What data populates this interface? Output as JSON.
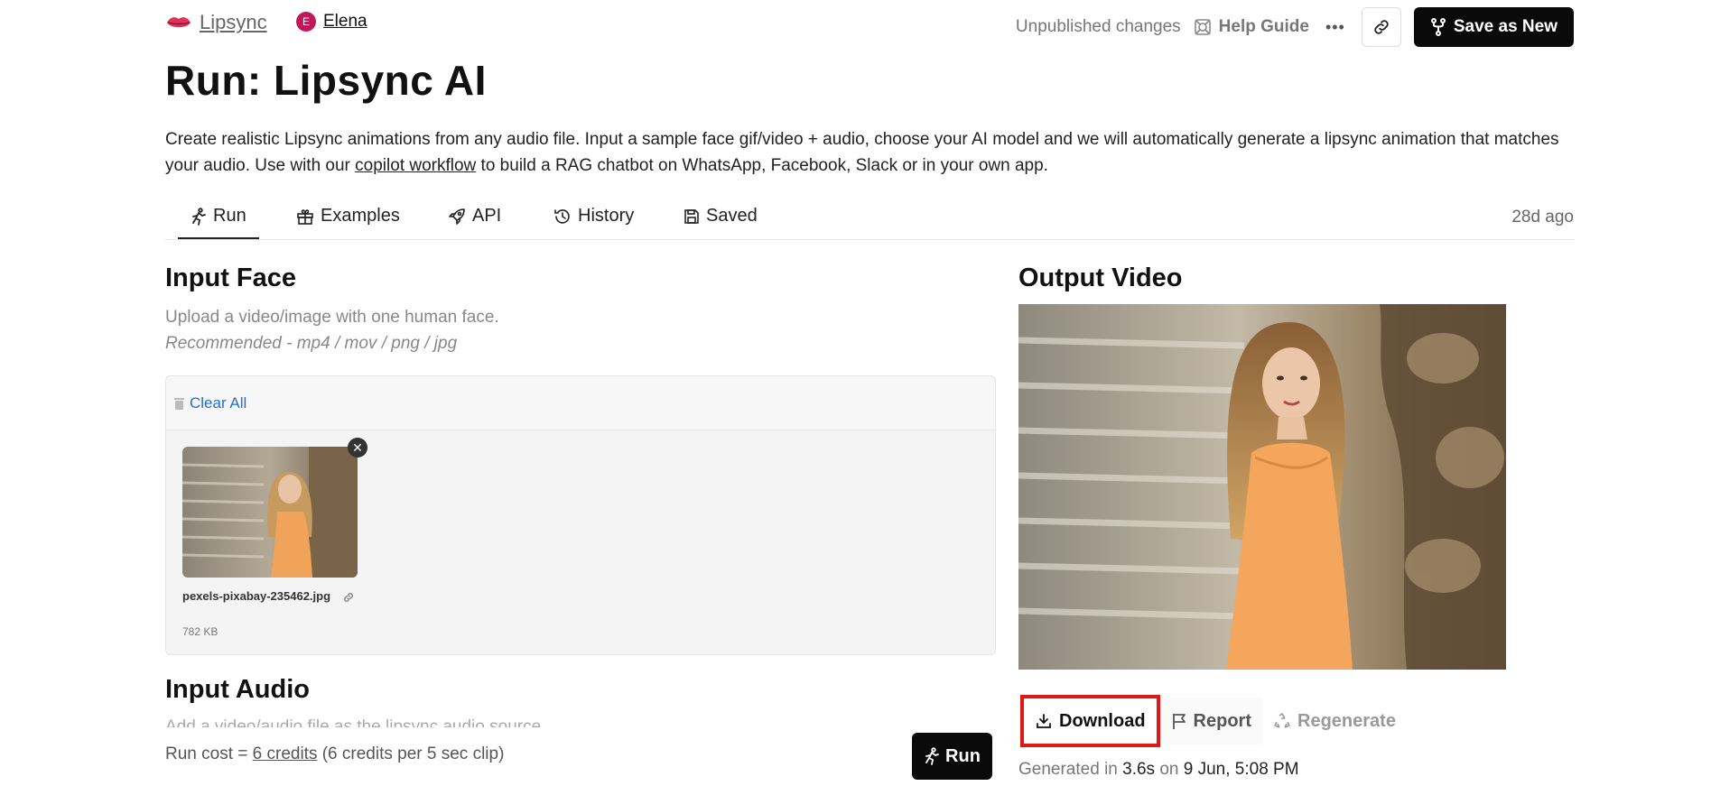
{
  "header": {
    "brand": "Lipsync",
    "user_initial": "E",
    "user_name": "Elena",
    "unpublished": "Unpublished changes",
    "help_guide": "Help Guide",
    "more": "•••",
    "save_label": "Save as New"
  },
  "page": {
    "title": "Run: Lipsync AI",
    "desc_part1": "Create realistic Lipsync animations from any audio file. Input a sample face gif/video + audio, choose your AI model and we will automatically generate a lipsync animation that matches your audio. Use with our ",
    "desc_link": "copilot workflow",
    "desc_part2": " to build a RAG chatbot on WhatsApp, Facebook, Slack or in your own app."
  },
  "tabs": [
    {
      "label": "Run"
    },
    {
      "label": "Examples"
    },
    {
      "label": "API"
    },
    {
      "label": "History"
    },
    {
      "label": "Saved"
    }
  ],
  "updated": "28d ago",
  "input_face": {
    "heading": "Input Face",
    "hint": "Upload a video/image with one human face.",
    "formats": "Recommended - mp4 / mov / png / jpg",
    "clear_all": "Clear All",
    "file_name": "pexels-pixabay-235462.jpg",
    "file_size": "782 KB"
  },
  "input_audio": {
    "heading": "Input Audio",
    "hint": "Add a video/audio file as the lipsync audio source."
  },
  "run_bar": {
    "cost_prefix": "Run cost = ",
    "cost_link": "6 credits",
    "cost_suffix": " (6 credits per 5 sec clip)",
    "run_label": "Run"
  },
  "output": {
    "heading": "Output Video",
    "download": "Download",
    "report": "Report",
    "regenerate": "Regenerate",
    "gen_prefix": "Generated in ",
    "gen_time": "3.6s",
    "gen_on": " on ",
    "gen_date": "9 Jun, 5:08 PM"
  },
  "colors": {
    "accent_link": "#1e6fd9",
    "primary_button": "#0a0a0a",
    "highlight_border": "#e01818",
    "avatar": "#c2185b"
  }
}
